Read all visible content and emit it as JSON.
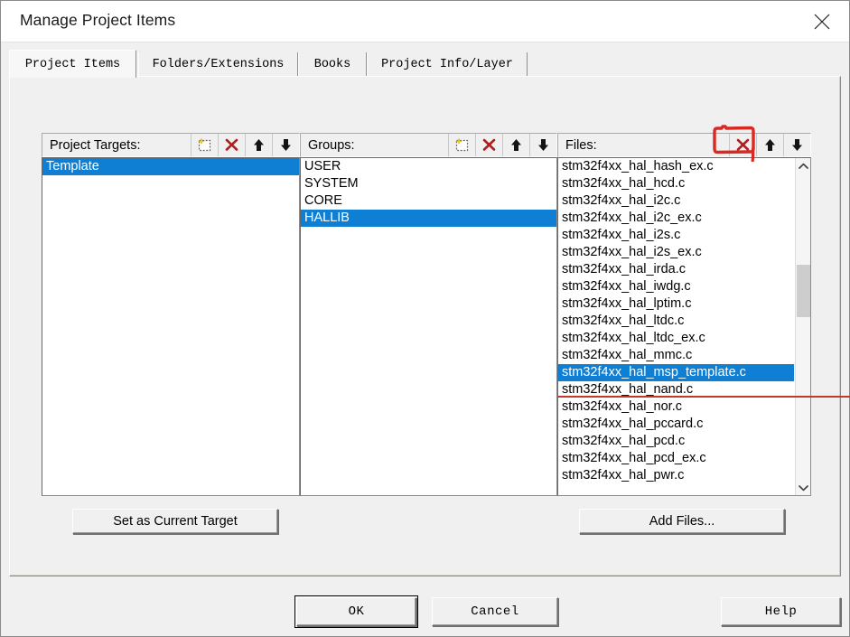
{
  "window": {
    "title": "Manage Project Items",
    "close_icon": "close-icon"
  },
  "tabs": [
    {
      "label": "Project Items",
      "active": true
    },
    {
      "label": "Folders/Extensions",
      "active": false
    },
    {
      "label": "Books",
      "active": false
    },
    {
      "label": "Project Info/Layer",
      "active": false
    }
  ],
  "columns": {
    "targets": {
      "label": "Project Targets:",
      "buttons": [
        {
          "name": "new-item-icon",
          "title": "New (Insert)"
        },
        {
          "name": "delete-icon",
          "title": "Remove Item"
        },
        {
          "name": "move-up-icon",
          "title": "Move Up"
        },
        {
          "name": "move-down-icon",
          "title": "Move Down"
        }
      ],
      "items": [
        "Template"
      ],
      "selected": "Template"
    },
    "groups": {
      "label": "Groups:",
      "buttons": [
        {
          "name": "new-item-icon",
          "title": "New (Insert)"
        },
        {
          "name": "delete-icon",
          "title": "Remove Item"
        },
        {
          "name": "move-up-icon",
          "title": "Move Up"
        },
        {
          "name": "move-down-icon",
          "title": "Move Down"
        }
      ],
      "items": [
        "USER",
        "SYSTEM",
        "CORE",
        "HALLIB"
      ],
      "selected": "HALLIB"
    },
    "files": {
      "label": "Files:",
      "buttons": [
        {
          "name": "delete-icon",
          "title": "Remove Item"
        },
        {
          "name": "move-up-icon",
          "title": "Move Up"
        },
        {
          "name": "move-down-icon",
          "title": "Move Down"
        }
      ],
      "items": [
        "stm32f4xx_hal_hash_ex.c",
        "stm32f4xx_hal_hcd.c",
        "stm32f4xx_hal_i2c.c",
        "stm32f4xx_hal_i2c_ex.c",
        "stm32f4xx_hal_i2s.c",
        "stm32f4xx_hal_i2s_ex.c",
        "stm32f4xx_hal_irda.c",
        "stm32f4xx_hal_iwdg.c",
        "stm32f4xx_hal_lptim.c",
        "stm32f4xx_hal_ltdc.c",
        "stm32f4xx_hal_ltdc_ex.c",
        "stm32f4xx_hal_mmc.c",
        "stm32f4xx_hal_msp_template.c",
        "stm32f4xx_hal_nand.c",
        "stm32f4xx_hal_nor.c",
        "stm32f4xx_hal_pccard.c",
        "stm32f4xx_hal_pcd.c",
        "stm32f4xx_hal_pcd_ex.c",
        "stm32f4xx_hal_pwr.c"
      ],
      "selected": "stm32f4xx_hal_msp_template.c"
    }
  },
  "actions": {
    "set_current_target": "Set as Current Target",
    "add_files": "Add Files..."
  },
  "footer": {
    "ok": "OK",
    "cancel": "Cancel",
    "help": "Help"
  },
  "annotations": {
    "color": "#c0392b",
    "box_target": "files-delete-button",
    "line_target": "selected-file-row"
  },
  "colors": {
    "selection": "#0f7fd4",
    "dialog_bg": "#f0f0f0",
    "list_bg": "#ffffff",
    "delete_icon": "#b01e1e",
    "annotation": "#c0392b"
  }
}
